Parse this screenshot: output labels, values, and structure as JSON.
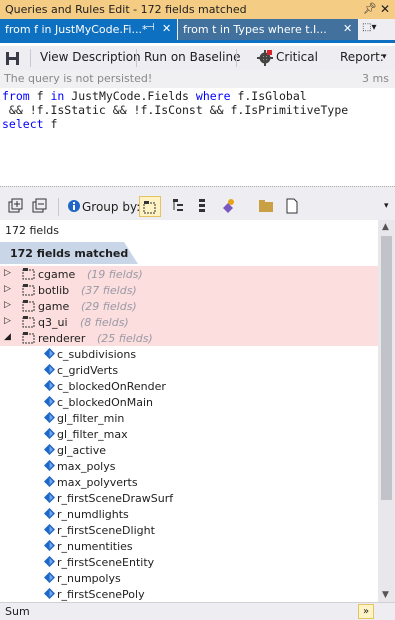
{
  "window": {
    "title": "Queries and Rules Edit  -  172 fields matched"
  },
  "tabs": [
    {
      "label": "from f in JustMyCode.Fi...*"
    },
    {
      "label": "from t in Types where t.I..."
    }
  ],
  "toolbar": {
    "view_description": "View Description",
    "run_on_baseline": "Run on Baseline",
    "critical": "Critical",
    "report": "Report:"
  },
  "status": {
    "message": "The query is not persisted!",
    "duration": "3 ms"
  },
  "query": {
    "line1": {
      "kw1": "from",
      "t1": " f ",
      "kw2": "in",
      "t2": " JustMyCode.Fields ",
      "kw3": "where",
      "t3": " f.IsGlobal"
    },
    "line2": " && !f.IsStatic && !f.IsConst && f.IsPrimitiveType",
    "line3": {
      "kw": "select",
      "t": " f"
    }
  },
  "results_toolbar": {
    "group_by_label": "Group by:"
  },
  "results": {
    "count_label": "172 fields",
    "header": "172 fields matched",
    "groups": [
      {
        "name": "cgame",
        "count": "(19 fields)",
        "expanded": false
      },
      {
        "name": "botlib",
        "count": "(37 fields)",
        "expanded": false
      },
      {
        "name": "game",
        "count": "(29 fields)",
        "expanded": false
      },
      {
        "name": "q3_ui",
        "count": "(8 fields)",
        "expanded": false
      },
      {
        "name": "renderer",
        "count": "(25 fields)",
        "expanded": true
      }
    ],
    "fields": [
      "c_subdivisions",
      "c_gridVerts",
      "c_blockedOnRender",
      "c_blockedOnMain",
      "gl_filter_min",
      "gl_filter_max",
      "gl_active",
      "max_polys",
      "max_polyverts",
      "r_firstSceneDrawSurf",
      "r_numdlights",
      "r_firstSceneDlight",
      "r_numentities",
      "r_firstSceneEntity",
      "r_numpolys",
      "r_firstScenePoly"
    ]
  },
  "footer": {
    "label": "Sum"
  },
  "colors": {
    "title_bar": "#f5cc84",
    "active_tab": "#0e70c0",
    "inactive_tab": "#41719c",
    "keyword": "#0000ff",
    "group_row": "#fbdedd",
    "header_band": "#c8d6e8",
    "field_icon": "#1f66c8"
  }
}
